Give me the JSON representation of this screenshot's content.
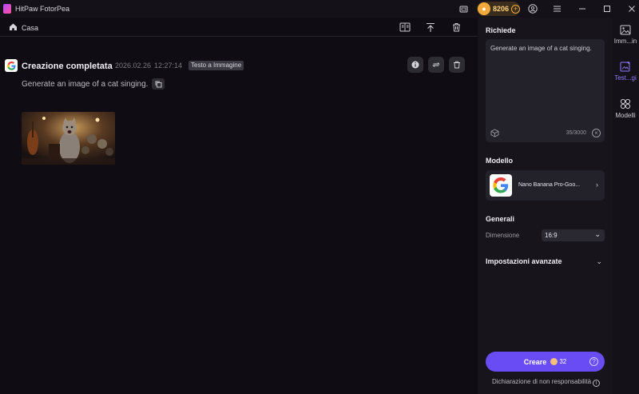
{
  "app": {
    "title": "HitPaw FotorPea",
    "coins": "8206"
  },
  "topbar": {
    "home_label": "Casa"
  },
  "generation": {
    "status": "Creazione completata",
    "date": "2026.02.26",
    "time": "12:27:14",
    "mode_tag": "Testo a Immagine",
    "prompt": "Generate an image of a cat singing."
  },
  "panel": {
    "prompt_title": "Richiede",
    "prompt_value": "Generate an image of a cat singing.",
    "char_count": "35/3000",
    "model_title": "Modello",
    "model_name": "Nano Banana Pro-Goo...",
    "general_title": "Generali",
    "dimension_label": "Dimensione",
    "dimension_value": "16:9",
    "advanced_title": "Impostazioni avanzate",
    "create_label": "Creare",
    "create_cost": "32",
    "disclaimer": "Dichiarazione di non responsabilità"
  },
  "rail": {
    "items": [
      {
        "label": "Imm...in",
        "icon": "image-icon"
      },
      {
        "label": "Test...gi",
        "icon": "text-to-image-icon",
        "active": true
      },
      {
        "label": "Modelli",
        "icon": "models-icon"
      }
    ]
  },
  "colors": {
    "accent": "#6a4cf4",
    "rail_active": "#8f7bff",
    "coin": "#f2a93b"
  }
}
